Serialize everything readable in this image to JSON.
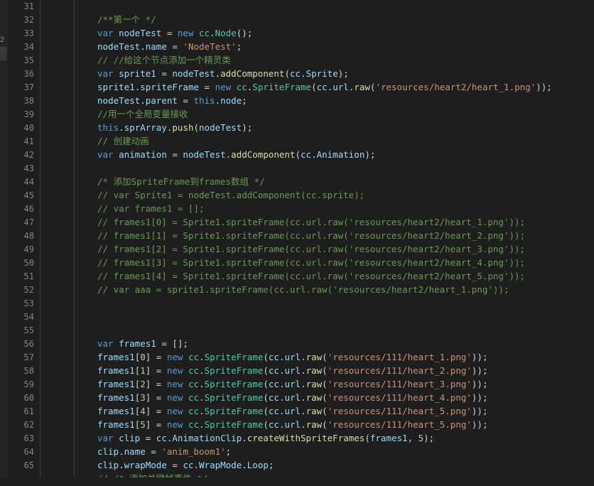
{
  "side_marker": "2",
  "lines": [
    {
      "n": "31",
      "tokens": []
    },
    {
      "n": "32",
      "tokens": [
        [
          "cm",
          "/**第一个 */"
        ]
      ]
    },
    {
      "n": "33",
      "tokens": [
        [
          "kw",
          "var "
        ],
        [
          "var",
          "nodeTest"
        ],
        [
          "pl",
          " = "
        ],
        [
          "kw",
          "new "
        ],
        [
          "cls",
          "cc"
        ],
        [
          "pl",
          "."
        ],
        [
          "cls",
          "Node"
        ],
        [
          "pl",
          "();"
        ]
      ]
    },
    {
      "n": "34",
      "tokens": [
        [
          "var",
          "nodeTest"
        ],
        [
          "pl",
          "."
        ],
        [
          "var",
          "name"
        ],
        [
          "pl",
          " = "
        ],
        [
          "str",
          "'NodeTest'"
        ],
        [
          "pl",
          ";"
        ]
      ]
    },
    {
      "n": "35",
      "tokens": [
        [
          "cm",
          "// //给这个节点添加一个精灵类"
        ]
      ]
    },
    {
      "n": "36",
      "tokens": [
        [
          "kw",
          "var "
        ],
        [
          "var",
          "sprite1"
        ],
        [
          "pl",
          " = "
        ],
        [
          "var",
          "nodeTest"
        ],
        [
          "pl",
          "."
        ],
        [
          "fn",
          "addComponent"
        ],
        [
          "pl",
          "("
        ],
        [
          "var",
          "cc"
        ],
        [
          "pl",
          "."
        ],
        [
          "var",
          "Sprite"
        ],
        [
          "pl",
          ");"
        ]
      ]
    },
    {
      "n": "37",
      "tokens": [
        [
          "var",
          "sprite1"
        ],
        [
          "pl",
          "."
        ],
        [
          "var",
          "spriteFrame"
        ],
        [
          "pl",
          " = "
        ],
        [
          "kw",
          "new "
        ],
        [
          "cls",
          "cc"
        ],
        [
          "pl",
          "."
        ],
        [
          "cls",
          "SpriteFrame"
        ],
        [
          "pl",
          "("
        ],
        [
          "var",
          "cc"
        ],
        [
          "pl",
          "."
        ],
        [
          "var",
          "url"
        ],
        [
          "pl",
          "."
        ],
        [
          "fn",
          "raw"
        ],
        [
          "pl",
          "("
        ],
        [
          "str",
          "'resources/heart2/heart_1.png'"
        ],
        [
          "pl",
          "));"
        ]
      ]
    },
    {
      "n": "38",
      "tokens": [
        [
          "var",
          "nodeTest"
        ],
        [
          "pl",
          "."
        ],
        [
          "var",
          "parent"
        ],
        [
          "pl",
          " = "
        ],
        [
          "kw",
          "this"
        ],
        [
          "pl",
          "."
        ],
        [
          "var",
          "node"
        ],
        [
          "pl",
          ";"
        ]
      ]
    },
    {
      "n": "39",
      "tokens": [
        [
          "cm",
          "//用一个全局变量接收"
        ]
      ]
    },
    {
      "n": "40",
      "tokens": [
        [
          "kw",
          "this"
        ],
        [
          "pl",
          "."
        ],
        [
          "var",
          "sprArray"
        ],
        [
          "pl",
          "."
        ],
        [
          "fn",
          "push"
        ],
        [
          "pl",
          "("
        ],
        [
          "var",
          "nodeTest"
        ],
        [
          "pl",
          ");"
        ]
      ]
    },
    {
      "n": "41",
      "tokens": [
        [
          "cm",
          "// 创建动画"
        ]
      ]
    },
    {
      "n": "42",
      "tokens": [
        [
          "kw",
          "var "
        ],
        [
          "var",
          "animation"
        ],
        [
          "pl",
          " = "
        ],
        [
          "var",
          "nodeTest"
        ],
        [
          "pl",
          "."
        ],
        [
          "fn",
          "addComponent"
        ],
        [
          "pl",
          "("
        ],
        [
          "var",
          "cc"
        ],
        [
          "pl",
          "."
        ],
        [
          "var",
          "Animation"
        ],
        [
          "pl",
          ");"
        ]
      ]
    },
    {
      "n": "43",
      "tokens": []
    },
    {
      "n": "44",
      "tokens": [
        [
          "cm",
          "/* 添加SpriteFrame到frames数组 */"
        ]
      ]
    },
    {
      "n": "45",
      "tokens": [
        [
          "cm",
          "// var Sprite1 = nodeTest.addComponent(cc.sprite);"
        ]
      ]
    },
    {
      "n": "46",
      "tokens": [
        [
          "cm",
          "// var frames1 = [];"
        ]
      ]
    },
    {
      "n": "47",
      "tokens": [
        [
          "cm",
          "// frames1[0] = Sprite1.spriteFrame(cc.url.raw('resources/heart2/heart_1.png'));"
        ]
      ]
    },
    {
      "n": "48",
      "tokens": [
        [
          "cm",
          "// frames1[1] = Sprite1.spriteFrame(cc.url.raw('resources/heart2/heart_2.png'));"
        ]
      ]
    },
    {
      "n": "49",
      "tokens": [
        [
          "cm",
          "// frames1[2] = Sprite1.spriteFrame(cc.url.raw('resources/heart2/heart_3.png'));"
        ]
      ]
    },
    {
      "n": "50",
      "tokens": [
        [
          "cm",
          "// frames1[3] = Sprite1.spriteFrame(cc.url.raw('resources/heart2/heart_4.png'));"
        ]
      ]
    },
    {
      "n": "51",
      "tokens": [
        [
          "cm",
          "// frames1[4] = Sprite1.spriteFrame(cc.url.raw('resources/heart2/heart_5.png'));"
        ]
      ]
    },
    {
      "n": "52",
      "tokens": [
        [
          "cm",
          "// var aaa = sprite1.spriteFrame(cc.url.raw('resources/heart2/heart_1.png'));"
        ]
      ]
    },
    {
      "n": "53",
      "tokens": []
    },
    {
      "n": "54",
      "tokens": []
    },
    {
      "n": "55",
      "tokens": []
    },
    {
      "n": "56",
      "tokens": [
        [
          "kw",
          "var "
        ],
        [
          "var",
          "frames1"
        ],
        [
          "pl",
          " = [];"
        ]
      ]
    },
    {
      "n": "57",
      "tokens": [
        [
          "var",
          "frames1"
        ],
        [
          "pl",
          "["
        ],
        [
          "num",
          "0"
        ],
        [
          "pl",
          "] = "
        ],
        [
          "kw",
          "new "
        ],
        [
          "cls",
          "cc"
        ],
        [
          "pl",
          "."
        ],
        [
          "cls",
          "SpriteFrame"
        ],
        [
          "pl",
          "("
        ],
        [
          "var",
          "cc"
        ],
        [
          "pl",
          "."
        ],
        [
          "var",
          "url"
        ],
        [
          "pl",
          "."
        ],
        [
          "fn",
          "raw"
        ],
        [
          "pl",
          "("
        ],
        [
          "str",
          "'resources/111/heart_1.png'"
        ],
        [
          "pl",
          "));"
        ]
      ]
    },
    {
      "n": "58",
      "tokens": [
        [
          "var",
          "frames1"
        ],
        [
          "pl",
          "["
        ],
        [
          "num",
          "1"
        ],
        [
          "pl",
          "] = "
        ],
        [
          "kw",
          "new "
        ],
        [
          "cls",
          "cc"
        ],
        [
          "pl",
          "."
        ],
        [
          "cls",
          "SpriteFrame"
        ],
        [
          "pl",
          "("
        ],
        [
          "var",
          "cc"
        ],
        [
          "pl",
          "."
        ],
        [
          "var",
          "url"
        ],
        [
          "pl",
          "."
        ],
        [
          "fn",
          "raw"
        ],
        [
          "pl",
          "("
        ],
        [
          "str",
          "'resources/111/heart_2.png'"
        ],
        [
          "pl",
          "));"
        ]
      ]
    },
    {
      "n": "59",
      "tokens": [
        [
          "var",
          "frames1"
        ],
        [
          "pl",
          "["
        ],
        [
          "num",
          "2"
        ],
        [
          "pl",
          "] = "
        ],
        [
          "kw",
          "new "
        ],
        [
          "cls",
          "cc"
        ],
        [
          "pl",
          "."
        ],
        [
          "cls",
          "SpriteFrame"
        ],
        [
          "pl",
          "("
        ],
        [
          "var",
          "cc"
        ],
        [
          "pl",
          "."
        ],
        [
          "var",
          "url"
        ],
        [
          "pl",
          "."
        ],
        [
          "fn",
          "raw"
        ],
        [
          "pl",
          "("
        ],
        [
          "str",
          "'resources/111/heart_3.png'"
        ],
        [
          "pl",
          "));"
        ]
      ]
    },
    {
      "n": "60",
      "tokens": [
        [
          "var",
          "frames1"
        ],
        [
          "pl",
          "["
        ],
        [
          "num",
          "3"
        ],
        [
          "pl",
          "] = "
        ],
        [
          "kw",
          "new "
        ],
        [
          "cls",
          "cc"
        ],
        [
          "pl",
          "."
        ],
        [
          "cls",
          "SpriteFrame"
        ],
        [
          "pl",
          "("
        ],
        [
          "var",
          "cc"
        ],
        [
          "pl",
          "."
        ],
        [
          "var",
          "url"
        ],
        [
          "pl",
          "."
        ],
        [
          "fn",
          "raw"
        ],
        [
          "pl",
          "("
        ],
        [
          "str",
          "'resources/111/heart_4.png'"
        ],
        [
          "pl",
          "));"
        ]
      ]
    },
    {
      "n": "61",
      "tokens": [
        [
          "var",
          "frames1"
        ],
        [
          "pl",
          "["
        ],
        [
          "num",
          "4"
        ],
        [
          "pl",
          "] = "
        ],
        [
          "kw",
          "new "
        ],
        [
          "cls",
          "cc"
        ],
        [
          "pl",
          "."
        ],
        [
          "cls",
          "SpriteFrame"
        ],
        [
          "pl",
          "("
        ],
        [
          "var",
          "cc"
        ],
        [
          "pl",
          "."
        ],
        [
          "var",
          "url"
        ],
        [
          "pl",
          "."
        ],
        [
          "fn",
          "raw"
        ],
        [
          "pl",
          "("
        ],
        [
          "str",
          "'resources/111/heart_5.png'"
        ],
        [
          "pl",
          "));"
        ]
      ]
    },
    {
      "n": "62",
      "tokens": [
        [
          "var",
          "frames1"
        ],
        [
          "pl",
          "["
        ],
        [
          "num",
          "5"
        ],
        [
          "pl",
          "] = "
        ],
        [
          "kw",
          "new "
        ],
        [
          "cls",
          "cc"
        ],
        [
          "pl",
          "."
        ],
        [
          "cls",
          "SpriteFrame"
        ],
        [
          "pl",
          "("
        ],
        [
          "var",
          "cc"
        ],
        [
          "pl",
          "."
        ],
        [
          "var",
          "url"
        ],
        [
          "pl",
          "."
        ],
        [
          "fn",
          "raw"
        ],
        [
          "pl",
          "("
        ],
        [
          "str",
          "'resources/111/heart_5.png'"
        ],
        [
          "pl",
          "));"
        ]
      ]
    },
    {
      "n": "63",
      "tokens": [
        [
          "kw",
          "var "
        ],
        [
          "var",
          "clip"
        ],
        [
          "pl",
          " = "
        ],
        [
          "var",
          "cc"
        ],
        [
          "pl",
          "."
        ],
        [
          "var",
          "AnimationClip"
        ],
        [
          "pl",
          "."
        ],
        [
          "fn",
          "createWithSpriteFrames"
        ],
        [
          "pl",
          "("
        ],
        [
          "var",
          "frames1"
        ],
        [
          "pl",
          ", "
        ],
        [
          "num",
          "5"
        ],
        [
          "pl",
          ");"
        ]
      ]
    },
    {
      "n": "64",
      "tokens": [
        [
          "var",
          "clip"
        ],
        [
          "pl",
          "."
        ],
        [
          "var",
          "name"
        ],
        [
          "pl",
          " = "
        ],
        [
          "str",
          "'anim_boom1'"
        ],
        [
          "pl",
          ";"
        ]
      ]
    },
    {
      "n": "65",
      "tokens": [
        [
          "var",
          "clip"
        ],
        [
          "pl",
          "."
        ],
        [
          "var",
          "wrapMode"
        ],
        [
          "pl",
          " = "
        ],
        [
          "var",
          "cc"
        ],
        [
          "pl",
          "."
        ],
        [
          "var",
          "WrapMode"
        ],
        [
          "pl",
          "."
        ],
        [
          "var",
          "Loop"
        ],
        [
          "pl",
          ";"
        ]
      ]
    },
    {
      "n": "",
      "tokens": [
        [
          "cm",
          "// /* 添加关键帧事件 */"
        ]
      ]
    }
  ],
  "colors": {
    "background": "#1e1e1e",
    "keyword": "#569cd6",
    "string": "#ce9178",
    "comment": "#6a9955",
    "function": "#dcdcaa",
    "class": "#4ec9b0",
    "variable": "#9cdcfe",
    "number": "#b5cea8"
  }
}
